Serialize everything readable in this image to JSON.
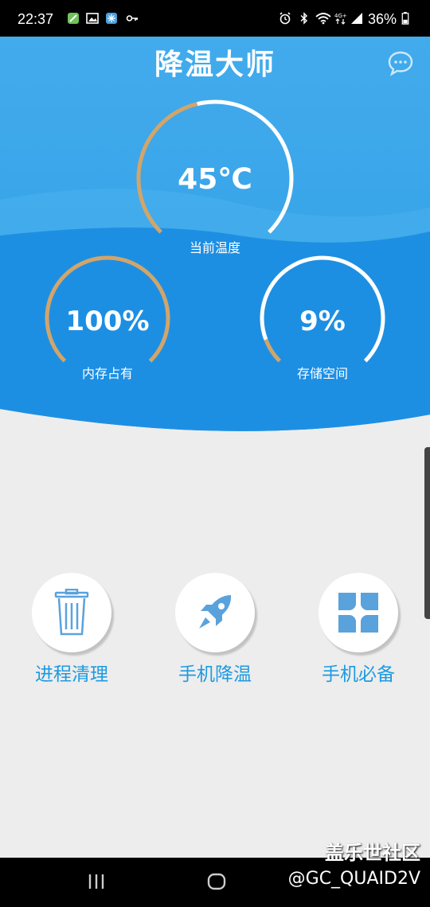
{
  "status_bar": {
    "time": "22:37",
    "battery": "36%",
    "icons": [
      "feather-app-icon",
      "image-icon",
      "snowflake-app-icon",
      "key-icon",
      "alarm-icon",
      "bluetooth-icon",
      "wifi-icon",
      "4g-icon",
      "signal-icon",
      "battery-icon"
    ]
  },
  "header": {
    "title": "降温大师",
    "chat_icon": "chat-bubble-icon"
  },
  "gauges": {
    "temperature": {
      "value": "45℃",
      "label": "当前温度",
      "fraction": 0.45
    },
    "memory": {
      "value": "100%",
      "label": "内存占有",
      "fraction": 1.0
    },
    "storage": {
      "value": "9%",
      "label": "存储空间",
      "fraction": 0.09
    }
  },
  "actions": [
    {
      "label": "进程清理",
      "icon": "trash-icon"
    },
    {
      "label": "手机降温",
      "icon": "rocket-icon"
    },
    {
      "label": "手机必备",
      "icon": "app-grid-icon"
    }
  ],
  "watermark": {
    "line1": "盖乐世社区",
    "line2": "@GC_QUAID2V"
  },
  "colors": {
    "hero_top": "#3fa9ea",
    "hero_bottom": "#1e8fe3",
    "arc_active": "#d1a56b",
    "arc_track": "#ffffff",
    "accent_text": "#1e9ae0",
    "background": "#ededed"
  }
}
